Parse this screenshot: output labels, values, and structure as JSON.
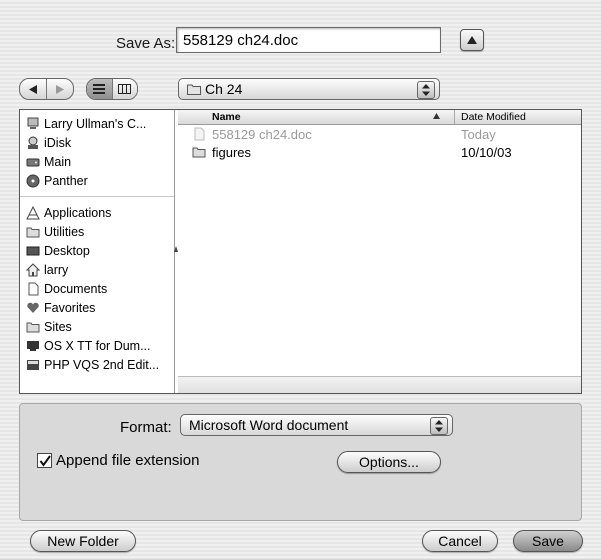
{
  "save_as": {
    "label": "Save As:",
    "value": "558129 ch24.doc"
  },
  "location": {
    "current": "Ch 24"
  },
  "sidebar": {
    "groups": [
      [
        {
          "label": "Larry Ullman's C...",
          "icon": "computer-icon"
        },
        {
          "label": "iDisk",
          "icon": "idisk-icon"
        },
        {
          "label": "Main",
          "icon": "hard-drive-icon"
        },
        {
          "label": "Panther",
          "icon": "disc-icon"
        }
      ],
      [
        {
          "label": "Applications",
          "icon": "applications-icon"
        },
        {
          "label": "Utilities",
          "icon": "folder-icon"
        },
        {
          "label": "Desktop",
          "icon": "desktop-icon"
        },
        {
          "label": "larry",
          "icon": "home-icon"
        },
        {
          "label": "Documents",
          "icon": "document-icon"
        },
        {
          "label": "Favorites",
          "icon": "heart-icon"
        },
        {
          "label": "Sites",
          "icon": "folder-icon"
        },
        {
          "label": "OS X TT for Dum...",
          "icon": "document-icon"
        },
        {
          "label": "PHP VQS 2nd Edit...",
          "icon": "document-icon"
        }
      ]
    ]
  },
  "file_list": {
    "columns": {
      "name": "Name",
      "date": "Date Modified"
    },
    "rows": [
      {
        "name": "558129 ch24.doc",
        "date": "Today",
        "icon": "document-icon",
        "enabled": false
      },
      {
        "name": "figures",
        "date": "10/10/03",
        "icon": "folder-icon",
        "enabled": true
      }
    ]
  },
  "format": {
    "label": "Format:",
    "value": "Microsoft Word document"
  },
  "append_extension": {
    "label": "Append file extension",
    "checked": true
  },
  "buttons": {
    "options": "Options...",
    "new_folder": "New Folder",
    "cancel": "Cancel",
    "save": "Save"
  }
}
